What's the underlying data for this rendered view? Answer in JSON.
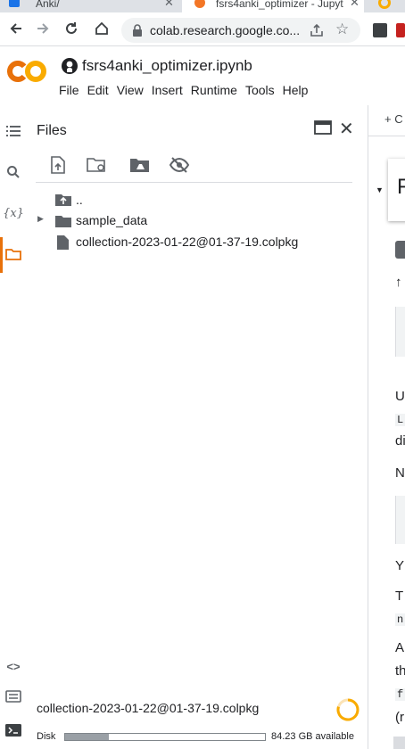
{
  "browser": {
    "tabs": [
      {
        "title": "Anki/"
      },
      {
        "title": "fsrs4anki_optimizer - Jupyt"
      }
    ],
    "url": "colab.research.google.co..."
  },
  "colab": {
    "logo_text": "CO",
    "notebook_title": "fsrs4anki_optimizer.ipynb",
    "menu": [
      "File",
      "Edit",
      "View",
      "Insert",
      "Runtime",
      "Tools",
      "Help"
    ]
  },
  "files_panel": {
    "title": "Files",
    "tree": [
      {
        "name": "..",
        "type": "parent"
      },
      {
        "name": "sample_data",
        "type": "folder"
      },
      {
        "name": "collection-2023-01-22@01-37-19.colpkg",
        "type": "file"
      }
    ],
    "status_file": "collection-2023-01-22@01-37-19.colpkg",
    "disk_label": "Disk",
    "disk_used_fraction": 0.22,
    "disk_available": "84.23 GB available"
  },
  "rail_icons": [
    "toc-icon",
    "search-icon",
    "variables-icon",
    "folder-icon",
    "code-icon",
    "command-palette-icon",
    "terminal-icon"
  ],
  "notebook_peek": {
    "toolbar_text": "+ C",
    "section_letter": "F",
    "lines": [
      "↑",
      "U",
      "L",
      "di",
      "N",
      "Y",
      "T",
      "n",
      "A",
      "th",
      "f",
      "(r"
    ]
  },
  "colors": {
    "accent": "#e8710a",
    "logo_orange": "#f9ab00",
    "icon_grey": "#5f6368"
  }
}
